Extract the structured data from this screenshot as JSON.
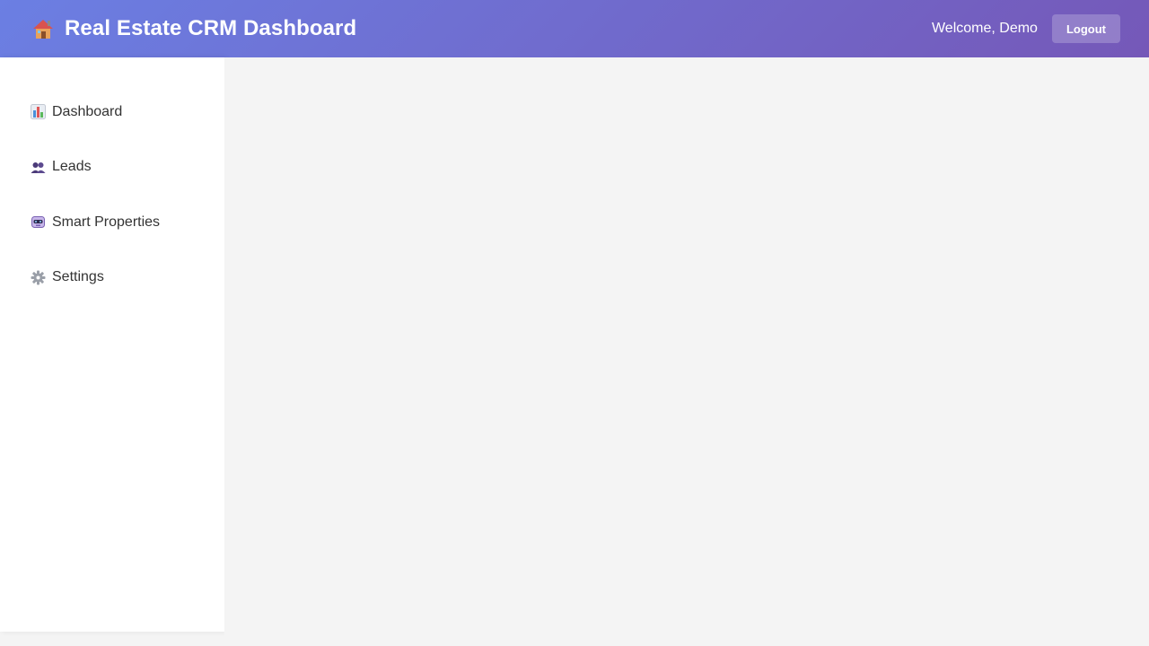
{
  "header": {
    "title": "Real Estate CRM Dashboard",
    "brand_icon": "house-icon",
    "welcome_text": "Welcome, Demo",
    "logout_label": "Logout",
    "gradient_start": "#6b7fe3",
    "gradient_end": "#7558b8"
  },
  "sidebar": {
    "items": [
      {
        "label": "Dashboard",
        "icon": "bar-chart-icon"
      },
      {
        "label": "Leads",
        "icon": "people-icon"
      },
      {
        "label": "Smart Properties",
        "icon": "robot-icon"
      },
      {
        "label": "Settings",
        "icon": "gear-icon"
      }
    ]
  }
}
